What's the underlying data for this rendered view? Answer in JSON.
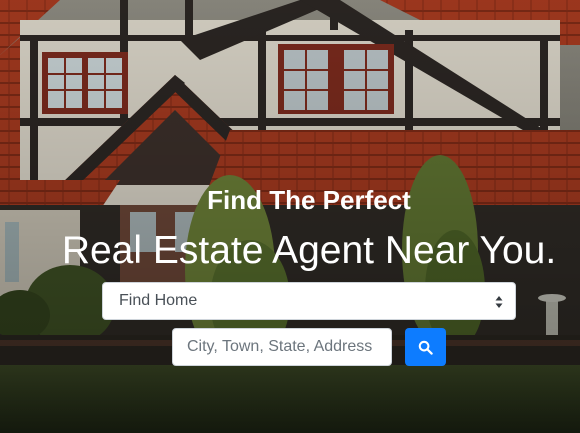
{
  "hero": {
    "heading_small": "Find The Perfect",
    "heading_large": "Real Estate Agent Near You."
  },
  "search": {
    "select_value": "Find Home",
    "input_placeholder": "City, Town, State, Address",
    "button_icon": "search-icon"
  },
  "colors": {
    "button": "#0d7cff",
    "text": "#ffffff",
    "roof": "#a3391f",
    "wall": "#d9d4c7"
  }
}
